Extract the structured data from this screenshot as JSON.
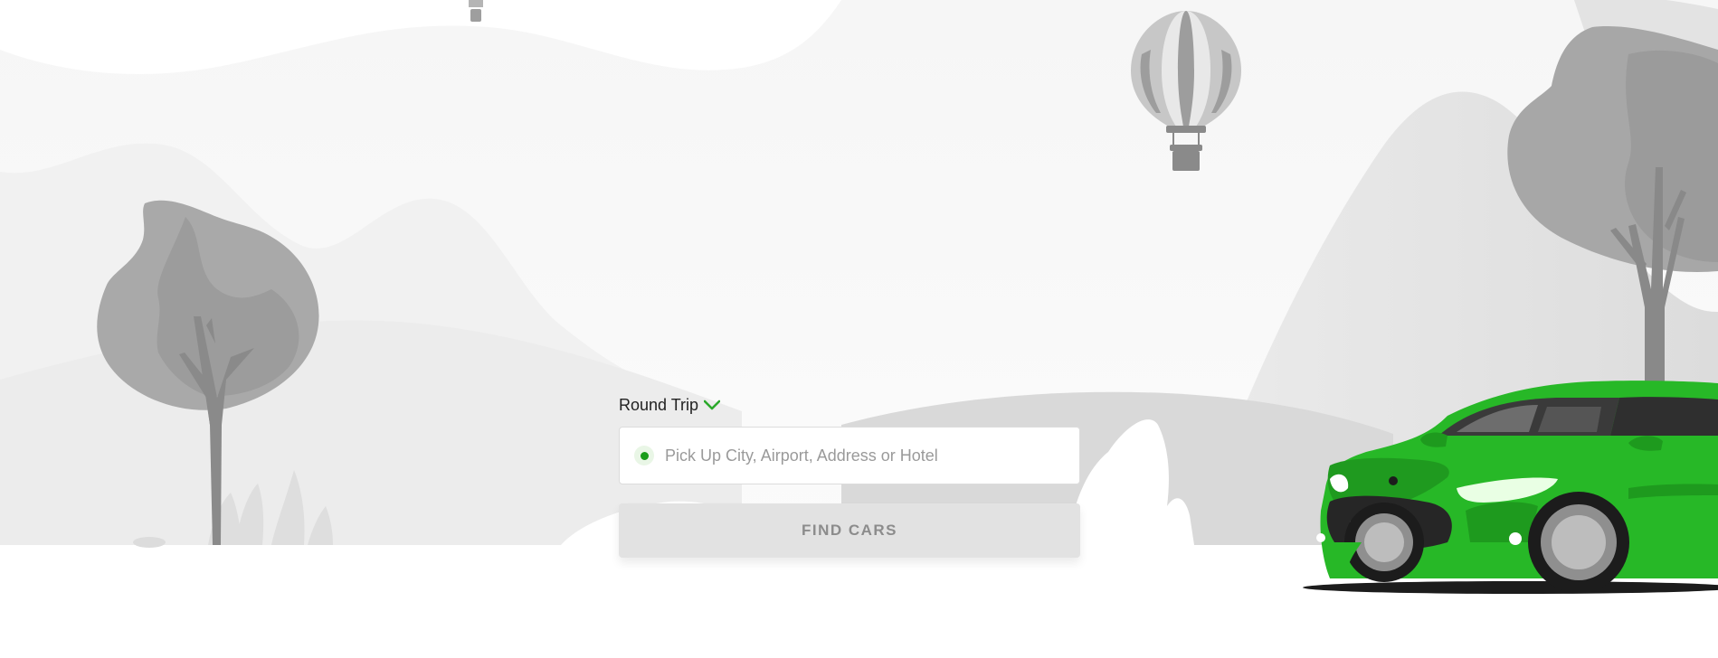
{
  "trip_type": {
    "selected": "Round Trip",
    "chevron_icon": "chevron-down-icon",
    "accent_color": "#2aa82a"
  },
  "pickup": {
    "value": "",
    "placeholder": "Pick Up City, Airport, Address or Hotel",
    "dot_color": "#1a9c1a"
  },
  "search_button": {
    "label": "FIND CARS"
  },
  "illustration": {
    "car_color": "#27b827",
    "elements": [
      "hot-air-balloon-icon",
      "tree-icon",
      "hills",
      "car-illustration"
    ]
  }
}
